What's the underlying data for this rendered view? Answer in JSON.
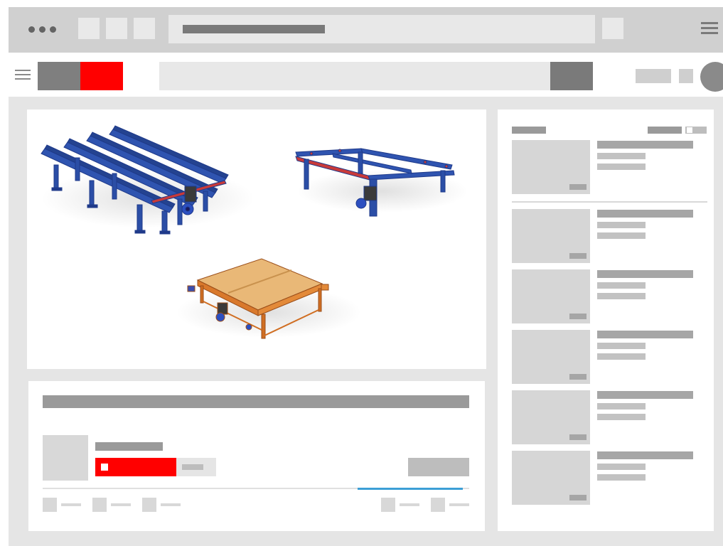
{
  "browser": {
    "window_controls": [
      "dot",
      "dot",
      "dot"
    ],
    "tabs": [
      "tab",
      "tab",
      "tab"
    ],
    "menu_icon": "hamburger-icon"
  },
  "header": {
    "menu_icon": "hamburger-icon",
    "logo_colors": [
      "#7f7f7f",
      "#ff0000"
    ],
    "search_placeholder": "",
    "avatar_icon": "avatar-circle"
  },
  "player": {
    "products": [
      {
        "name": "blue-conveyor-line",
        "color": "#2e4fa8"
      },
      {
        "name": "blue-frame-transfer",
        "color": "#2e4fa8"
      },
      {
        "name": "orange-wooden-table",
        "color": "#e07a2c"
      }
    ],
    "progress": 0.0
  },
  "video_info": {
    "subscribe_color": "#ff0000",
    "engagement_progress": 0.75,
    "accent_color": "#3c9fd6"
  },
  "sidebar": {
    "recommendation_count": 6
  },
  "colors": {
    "brand": "#ff0000",
    "placeholder_dark": "#7a7a7a",
    "placeholder_light": "#d6d6d6",
    "accent": "#3c9fd6"
  }
}
